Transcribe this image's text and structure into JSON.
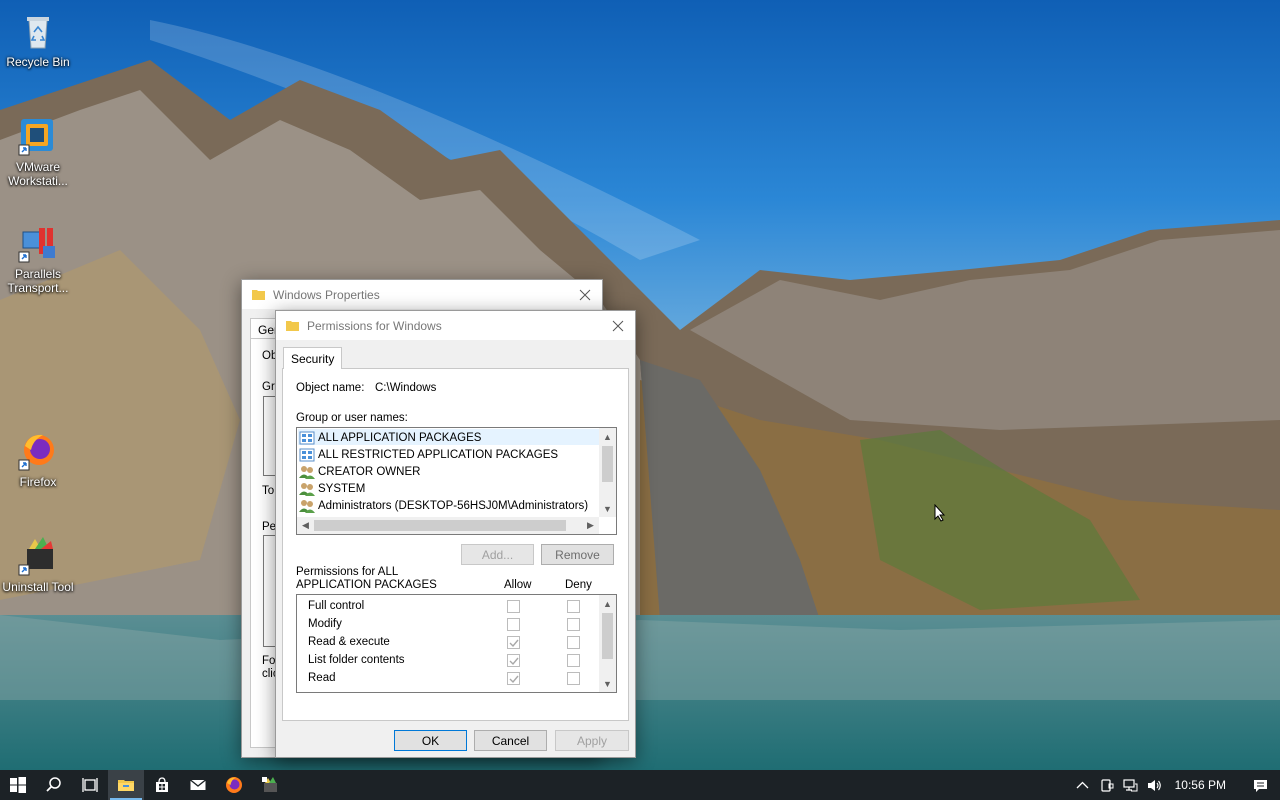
{
  "desktop": {
    "icons": [
      {
        "label": "Recycle Bin"
      },
      {
        "label": "VMware Workstati..."
      },
      {
        "label": "Parallels Transport..."
      },
      {
        "label": "Firefox"
      },
      {
        "label": "Uninstall Tool"
      }
    ]
  },
  "properties_window": {
    "title": "Windows Properties",
    "tab_partial": "Gen",
    "fragments": [
      "Ob",
      "Gro",
      "To",
      "Pe",
      "For",
      "clic"
    ]
  },
  "permissions_dialog": {
    "title": "Permissions for Windows",
    "tab": "Security",
    "object_name_label": "Object name:",
    "object_name_value": "C:\\Windows",
    "group_label": "Group or user names:",
    "groups": [
      {
        "name": "ALL APPLICATION PACKAGES"
      },
      {
        "name": "ALL RESTRICTED APPLICATION PACKAGES"
      },
      {
        "name": "CREATOR OWNER"
      },
      {
        "name": "SYSTEM"
      },
      {
        "name": "Administrators (DESKTOP-56HSJ0M\\Administrators)"
      }
    ],
    "add_button": "Add...",
    "remove_button": "Remove",
    "permissions_for_line1": "Permissions for ALL",
    "permissions_for_line2": "APPLICATION PACKAGES",
    "allow_header": "Allow",
    "deny_header": "Deny",
    "permissions": [
      {
        "name": "Full control",
        "allow": false,
        "deny": false
      },
      {
        "name": "Modify",
        "allow": false,
        "deny": false
      },
      {
        "name": "Read & execute",
        "allow": true,
        "deny": false
      },
      {
        "name": "List folder contents",
        "allow": true,
        "deny": false
      },
      {
        "name": "Read",
        "allow": true,
        "deny": false
      }
    ],
    "ok_button": "OK",
    "cancel_button": "Cancel",
    "apply_button": "Apply"
  },
  "taskbar": {
    "clock": "10:56 PM"
  },
  "colors": {
    "accent": "#0078d7",
    "taskbar": "#1c2226",
    "active_indicator": "#76b9ed",
    "selection": "#e5f3ff"
  }
}
